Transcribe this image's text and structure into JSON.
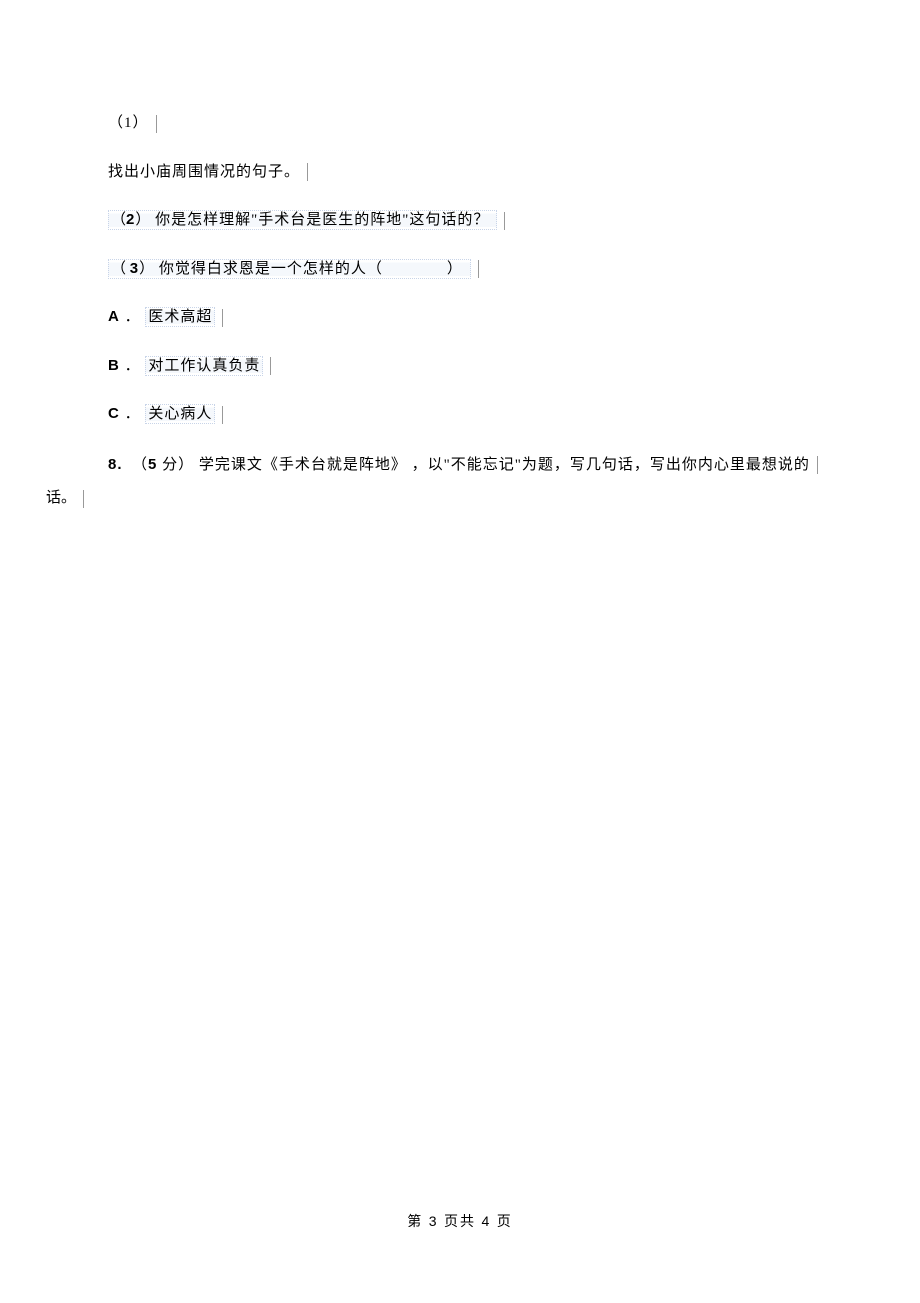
{
  "q1_number": "（1）",
  "q1_text": "找出小庙周围情况的句子。",
  "q2": "（2） 你是怎样理解\"手术台是医生的阵地\"这句话的？",
  "q3_prefix": "（3） 你觉得白求恩是一个怎样的人（",
  "q3_suffix": "）",
  "option_a_label": "A",
  "option_a_text": "． 医术高超",
  "option_b_label": "B",
  "option_b_text": "． 对工作认真负责",
  "option_c_label": "C",
  "option_c_text": "． 关心病人",
  "q8_num": "8.",
  "q8_points": "（5 分）",
  "q8_text1": " 学完课文《手术台就是阵地》   ，以\"不能忘记\"为题，写几句话，写出你内心里最想说的",
  "q8_text2": "话。",
  "footer_prefix": "第   ",
  "footer_page": "3",
  "footer_mid": " 页共 ",
  "footer_total": "4",
  "footer_suffix": " 页"
}
